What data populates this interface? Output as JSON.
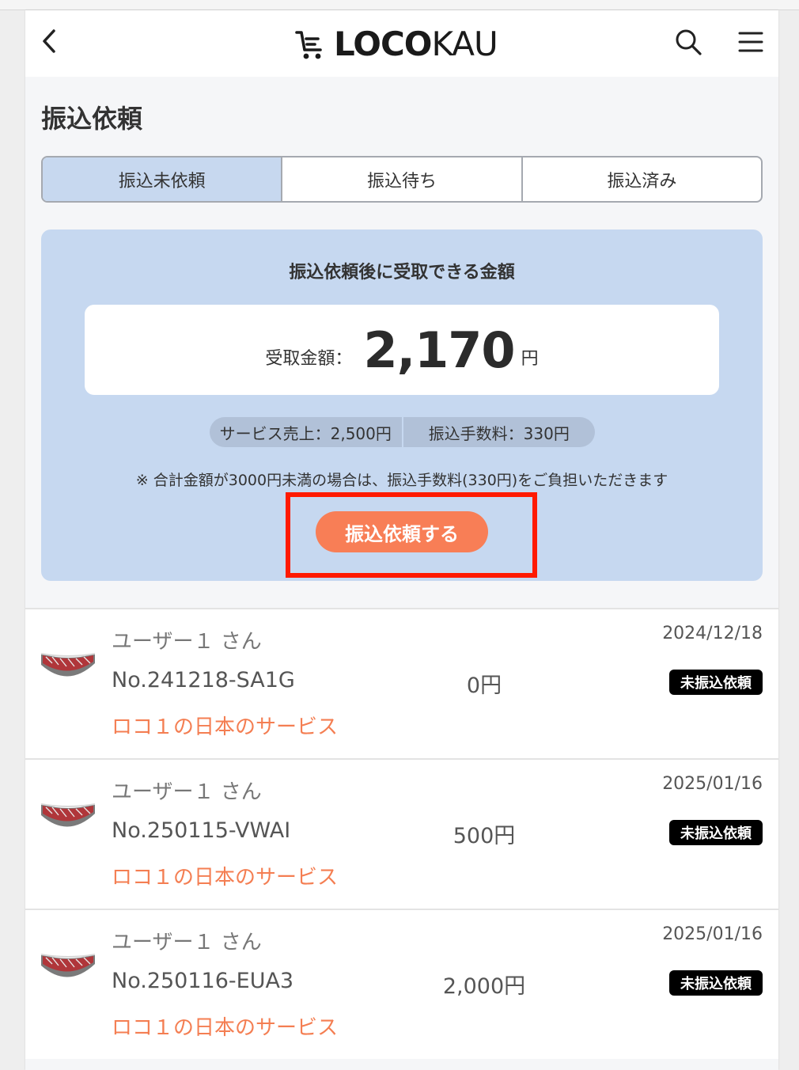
{
  "header": {
    "logo_bold": "LOCO",
    "logo_light": "KAU"
  },
  "page_title": "振込依頼",
  "tabs": [
    {
      "label": "振込未依頼",
      "active": true
    },
    {
      "label": "振込待ち",
      "active": false
    },
    {
      "label": "振込済み",
      "active": false
    }
  ],
  "panel": {
    "title": "振込依頼後に受取できる金額",
    "amount_label": "受取金額：",
    "amount_value": "2,170",
    "amount_unit": "円",
    "service_sales": "サービス売上：2,500円",
    "transfer_fee": "振込手数料：330円",
    "note": "※ 合計金額が3000円未満の場合は、振込手数料(330円)をご負担いただきます",
    "cta_label": "振込依頼する"
  },
  "transactions": [
    {
      "user": "ユーザー１ さん",
      "order_no": "No.241218-SA1G",
      "service": "ロコ１の日本のサービス",
      "amount": "0円",
      "date": "2024/12/18",
      "status": "未振込依頼"
    },
    {
      "user": "ユーザー１ さん",
      "order_no": "No.250115-VWAI",
      "service": "ロコ１の日本のサービス",
      "amount": "500円",
      "date": "2025/01/16",
      "status": "未振込依頼"
    },
    {
      "user": "ユーザー１ さん",
      "order_no": "No.250116-EUA3",
      "service": "ロコ１の日本のサービス",
      "amount": "2,000円",
      "date": "2025/01/16",
      "status": "未振込依頼"
    }
  ],
  "colors": {
    "accent_orange": "#f87e56",
    "service_text": "#f47e52",
    "panel_bg": "#c6d8f0",
    "active_tab_bg": "#c7d8ef",
    "highlight_red": "#ff1a00",
    "badge_bg": "#000000"
  },
  "icons": [
    "chevron-left-icon",
    "cart-icon",
    "search-icon",
    "hamburger-menu-icon"
  ]
}
